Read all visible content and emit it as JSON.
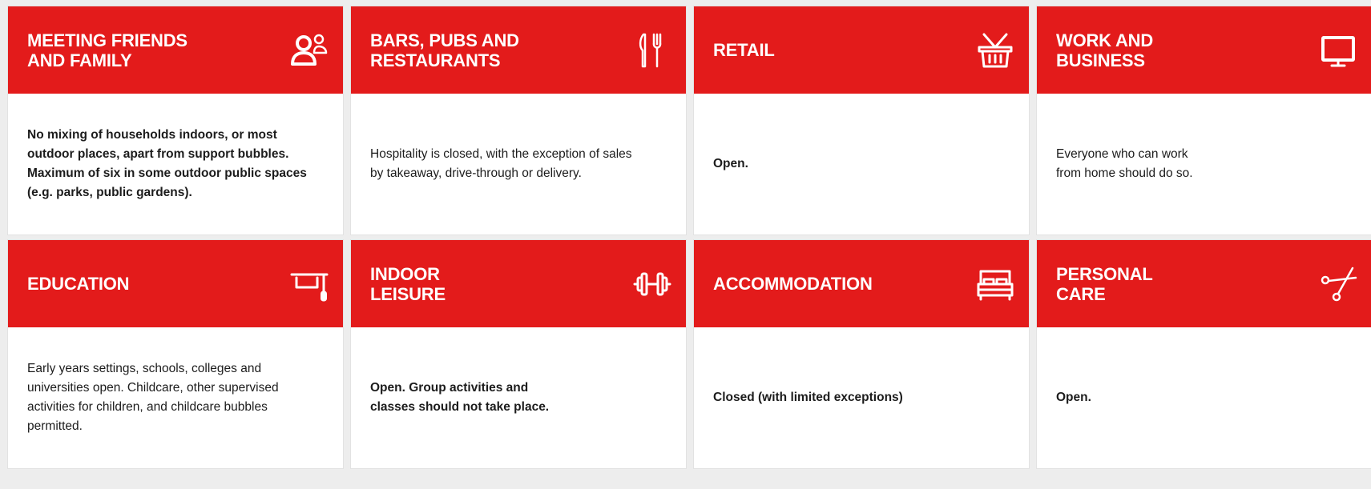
{
  "colors": {
    "header": "#e31b1b",
    "page_background": "#ededed",
    "card_background": "#ffffff",
    "header_text": "#ffffff",
    "body_text": "#1c1c1c"
  },
  "cards": [
    {
      "title": "MEETING FRIENDS\nAND FAMILY",
      "icon": "people-icon",
      "text": "No mixing of households indoors, or most\noutdoor places, apart from support bubbles.\nMaximum of six in some outdoor public spaces\n(e.g. parks, public gardens).",
      "text_bold": true
    },
    {
      "title": "BARS, PUBS AND\nRESTAURANTS",
      "icon": "knife-fork-icon",
      "text": "Hospitality is closed, with the exception of sales\nby takeaway, drive-through or delivery.",
      "text_bold": false
    },
    {
      "title": "RETAIL",
      "icon": "shopping-basket-icon",
      "text": "Open.",
      "text_bold": true
    },
    {
      "title": "WORK AND\nBUSINESS",
      "icon": "monitor-icon",
      "text": "Everyone who can work\nfrom home should do so.",
      "text_bold": false
    },
    {
      "title": "EDUCATION",
      "icon": "graduation-cap-icon",
      "text": "Early years settings, schools, colleges and\nuniversities open. Childcare, other supervised\nactivities for children, and childcare bubbles\npermitted.",
      "text_bold": false
    },
    {
      "title": "INDOOR\nLEISURE",
      "icon": "dumbbell-icon",
      "text": "Open. Group activities and\nclasses should not take place.",
      "text_bold": true
    },
    {
      "title": "ACCOMMODATION",
      "icon": "bed-icon",
      "text": "Closed (with limited exceptions)",
      "text_bold": true
    },
    {
      "title": "PERSONAL\nCARE",
      "icon": "scissors-icon",
      "text": "Open.",
      "text_bold": true
    }
  ]
}
